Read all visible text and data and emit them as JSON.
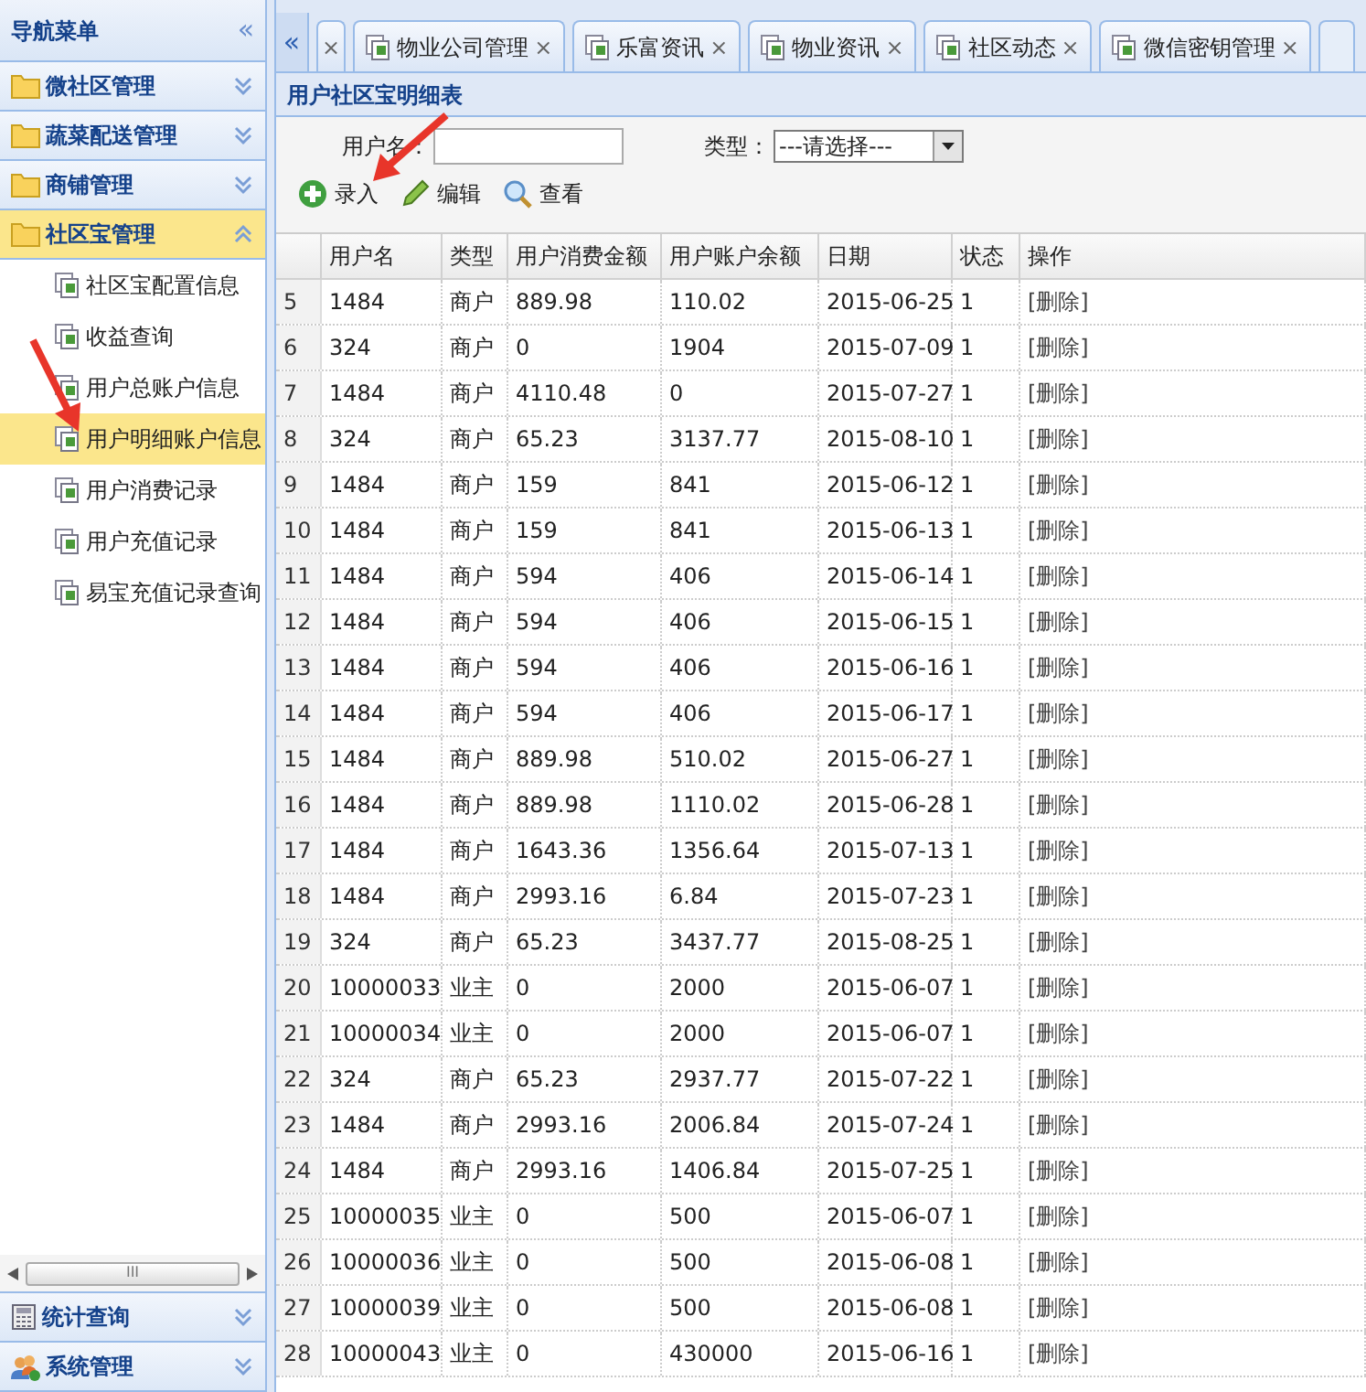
{
  "sidebar": {
    "title": "导航菜单",
    "collapse": "«",
    "sections": [
      {
        "label": "微社区管理",
        "kind": "folder",
        "expanded": false,
        "selected": false
      },
      {
        "label": "蔬菜配送管理",
        "kind": "folder",
        "expanded": false,
        "selected": false
      },
      {
        "label": "商铺管理",
        "kind": "folder",
        "expanded": false,
        "selected": false
      },
      {
        "label": "社区宝管理",
        "kind": "folder",
        "expanded": true,
        "selected": true,
        "items": [
          {
            "label": "社区宝配置信息",
            "selected": false
          },
          {
            "label": "收益查询",
            "selected": false
          },
          {
            "label": "用户总账户信息",
            "selected": false
          },
          {
            "label": "用户明细账户信息",
            "selected": true
          },
          {
            "label": "用户消费记录",
            "selected": false
          },
          {
            "label": "用户充值记录",
            "selected": false
          },
          {
            "label": "易宝充值记录查询",
            "selected": false
          }
        ]
      }
    ],
    "scrollbar_grip": "III",
    "bottom_sections": [
      {
        "label": "统计查询",
        "kind": "calculator",
        "expanded": false
      },
      {
        "label": "系统管理",
        "kind": "users",
        "expanded": false
      }
    ]
  },
  "tabs": {
    "scroll_left": "«",
    "items": [
      {
        "close": "×",
        "selected": false
      },
      {
        "label": "物业公司管理",
        "close": "×",
        "selected": false
      },
      {
        "label": "乐富资讯",
        "close": "×",
        "selected": false
      },
      {
        "label": "物业资讯",
        "close": "×",
        "selected": false
      },
      {
        "label": "社区动态",
        "close": "×",
        "selected": false
      },
      {
        "label": "微信密钥管理",
        "close": "×",
        "selected": false
      }
    ]
  },
  "panel": {
    "title": "用户社区宝明细表",
    "filters": [
      {
        "label": "用户名：",
        "kind": "text"
      },
      {
        "label": "类型：",
        "kind": "select",
        "value": "---请选择---"
      }
    ],
    "toolbar": [
      {
        "label": "录入",
        "kind": "add"
      },
      {
        "label": "编辑",
        "kind": "edit"
      },
      {
        "label": "查看",
        "kind": "view"
      }
    ],
    "table": {
      "columns": [
        "用户名",
        "类型",
        "用户消费金额",
        "用户账户余额",
        "日期",
        "状态",
        "操作"
      ],
      "rows": [
        {
          "no": "5",
          "cells": [
            "1484",
            "商户",
            "889.98",
            "110.02",
            "2015-06-25",
            "1",
            "[删除]"
          ]
        },
        {
          "no": "6",
          "cells": [
            "324",
            "商户",
            "0",
            "1904",
            "2015-07-09",
            "1",
            "[删除]"
          ]
        },
        {
          "no": "7",
          "cells": [
            "1484",
            "商户",
            "4110.48",
            "0",
            "2015-07-27",
            "1",
            "[删除]"
          ]
        },
        {
          "no": "8",
          "cells": [
            "324",
            "商户",
            "65.23",
            "3137.77",
            "2015-08-10",
            "1",
            "[删除]"
          ]
        },
        {
          "no": "9",
          "cells": [
            "1484",
            "商户",
            "159",
            "841",
            "2015-06-12",
            "1",
            "[删除]"
          ]
        },
        {
          "no": "10",
          "cells": [
            "1484",
            "商户",
            "159",
            "841",
            "2015-06-13",
            "1",
            "[删除]"
          ]
        },
        {
          "no": "11",
          "cells": [
            "1484",
            "商户",
            "594",
            "406",
            "2015-06-14",
            "1",
            "[删除]"
          ]
        },
        {
          "no": "12",
          "cells": [
            "1484",
            "商户",
            "594",
            "406",
            "2015-06-15",
            "1",
            "[删除]"
          ]
        },
        {
          "no": "13",
          "cells": [
            "1484",
            "商户",
            "594",
            "406",
            "2015-06-16",
            "1",
            "[删除]"
          ]
        },
        {
          "no": "14",
          "cells": [
            "1484",
            "商户",
            "594",
            "406",
            "2015-06-17",
            "1",
            "[删除]"
          ]
        },
        {
          "no": "15",
          "cells": [
            "1484",
            "商户",
            "889.98",
            "510.02",
            "2015-06-27",
            "1",
            "[删除]"
          ]
        },
        {
          "no": "16",
          "cells": [
            "1484",
            "商户",
            "889.98",
            "1110.02",
            "2015-06-28",
            "1",
            "[删除]"
          ]
        },
        {
          "no": "17",
          "cells": [
            "1484",
            "商户",
            "1643.36",
            "1356.64",
            "2015-07-13",
            "1",
            "[删除]"
          ]
        },
        {
          "no": "18",
          "cells": [
            "1484",
            "商户",
            "2993.16",
            "6.84",
            "2015-07-23",
            "1",
            "[删除]"
          ]
        },
        {
          "no": "19",
          "cells": [
            "324",
            "商户",
            "65.23",
            "3437.77",
            "2015-08-25",
            "1",
            "[删除]"
          ]
        },
        {
          "no": "20",
          "cells": [
            "10000033",
            "业主",
            "0",
            "2000",
            "2015-06-07",
            "1",
            "[删除]"
          ]
        },
        {
          "no": "21",
          "cells": [
            "10000034",
            "业主",
            "0",
            "2000",
            "2015-06-07",
            "1",
            "[删除]"
          ]
        },
        {
          "no": "22",
          "cells": [
            "324",
            "商户",
            "65.23",
            "2937.77",
            "2015-07-22",
            "1",
            "[删除]"
          ]
        },
        {
          "no": "23",
          "cells": [
            "1484",
            "商户",
            "2993.16",
            "2006.84",
            "2015-07-24",
            "1",
            "[删除]"
          ]
        },
        {
          "no": "24",
          "cells": [
            "1484",
            "商户",
            "2993.16",
            "1406.84",
            "2015-07-25",
            "1",
            "[删除]"
          ]
        },
        {
          "no": "25",
          "cells": [
            "10000035",
            "业主",
            "0",
            "500",
            "2015-06-07",
            "1",
            "[删除]"
          ]
        },
        {
          "no": "26",
          "cells": [
            "10000036",
            "业主",
            "0",
            "500",
            "2015-06-08",
            "1",
            "[删除]"
          ]
        },
        {
          "no": "27",
          "cells": [
            "10000039",
            "业主",
            "0",
            "500",
            "2015-06-08",
            "1",
            "[删除]"
          ]
        },
        {
          "no": "28",
          "cells": [
            "10000043",
            "业主",
            "0",
            "430000",
            "2015-06-16",
            "1",
            "[删除]"
          ]
        }
      ]
    }
  },
  "annotations": [
    {
      "kind": "arrow"
    },
    {
      "kind": "arrow"
    }
  ]
}
